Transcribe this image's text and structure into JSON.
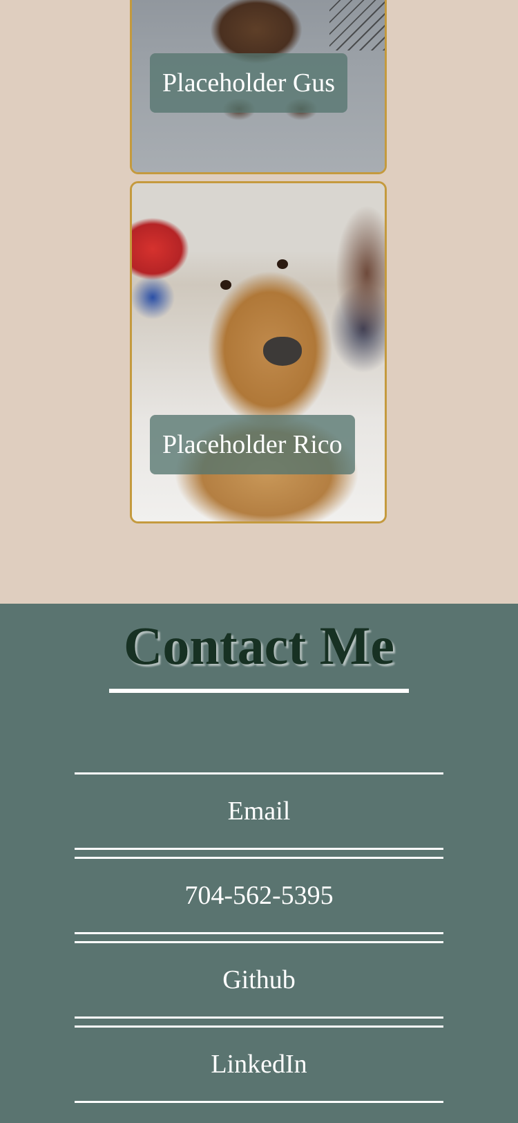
{
  "gallery": {
    "cards": [
      {
        "name": "Placeholder Gus",
        "image": "brown-puppy-photo"
      },
      {
        "name": "Placeholder Rico",
        "image": "golden-retriever-photo"
      }
    ]
  },
  "contact": {
    "title": "Contact Me",
    "items": [
      {
        "label": "Email"
      },
      {
        "label": "704-562-5395"
      },
      {
        "label": "Github"
      },
      {
        "label": "LinkedIn"
      }
    ]
  },
  "colors": {
    "gallery_bg": "#dfcebf",
    "card_border": "#c49a3e",
    "name_tag_bg": "#567670",
    "contact_bg": "#5a7470",
    "title_text": "#173123",
    "contact_text": "#ffffff"
  }
}
